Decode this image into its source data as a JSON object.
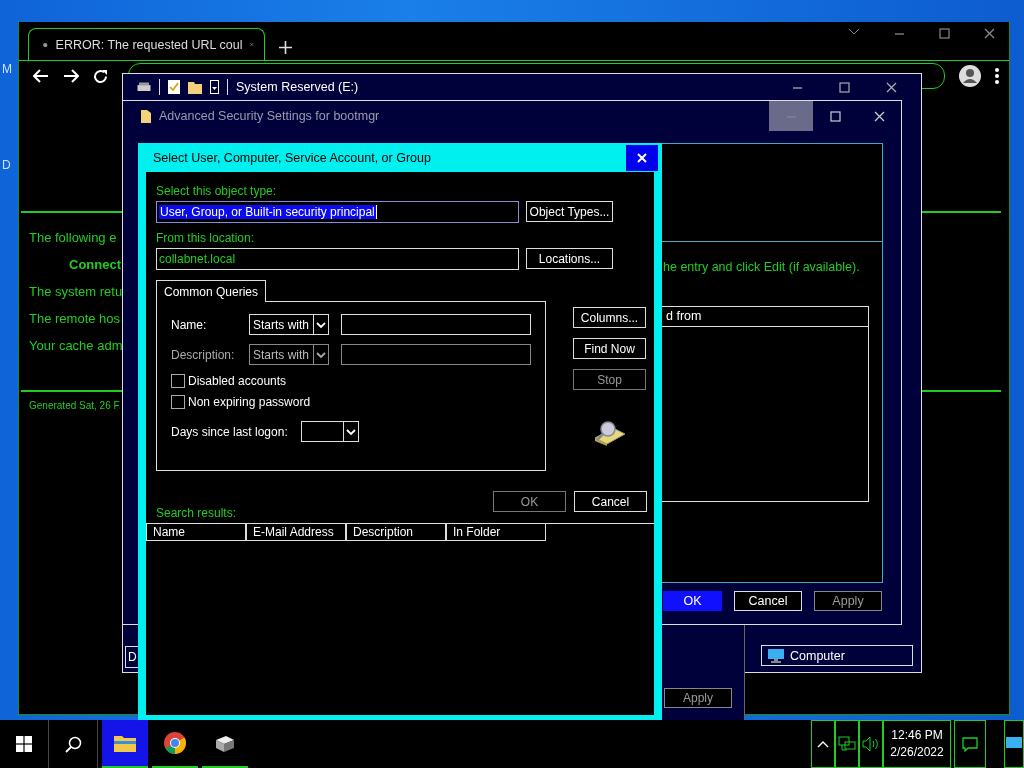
{
  "desktop_icons": [
    {
      "label": "M"
    },
    {
      "label": "D"
    }
  ],
  "browser": {
    "tab_title": "ERROR: The requested URL coul",
    "page_lines": [
      {
        "text": "The following e",
        "kind": "normal"
      },
      {
        "text": "Connect",
        "kind": "heading"
      },
      {
        "text": "The system retu",
        "kind": "normal"
      },
      {
        "text": "The remote hos",
        "kind": "normal"
      },
      {
        "text": "Your cache adm",
        "kind": "normal"
      }
    ],
    "footer": "Generated Sat, 26 F"
  },
  "explorer": {
    "title": "System Reserved (E:)",
    "cut_label": "D",
    "status_item": "Computer",
    "apply_button": "Apply"
  },
  "security_window": {
    "title": "Advanced Security Settings for bootmgr",
    "hint": "he entry and click Edit (if available).",
    "column": "d from",
    "buttons": [
      {
        "label": "OK",
        "kind": "default"
      },
      {
        "label": "Cancel",
        "kind": "normal"
      },
      {
        "label": "Apply",
        "kind": "disabled"
      }
    ]
  },
  "dialog": {
    "title": "Select User, Computer, Service Account, or Group",
    "object_type_label": "Select this object type:",
    "object_type": "User, Group, or Built-in security principal",
    "object_types_button": "Object Types...",
    "location_label": "From this location:",
    "location": "collabnet.local",
    "locations_button": "Locations...",
    "tab": "Common Queries",
    "queries": [
      {
        "label": "Name:",
        "match": "Starts with",
        "disabled": false
      },
      {
        "label": "Description:",
        "match": "Starts with",
        "disabled": true
      }
    ],
    "checkboxes": [
      {
        "label": "Disabled accounts",
        "checked": false
      },
      {
        "label": "Non expiring password",
        "checked": false
      }
    ],
    "days_label": "Days since last logon:",
    "side_buttons": [
      {
        "label": "Columns...",
        "disabled": false
      },
      {
        "label": "Find Now",
        "disabled": false
      },
      {
        "label": "Stop",
        "disabled": true
      }
    ],
    "buttons": [
      {
        "label": "OK",
        "disabled": true
      },
      {
        "label": "Cancel",
        "disabled": false
      }
    ],
    "results_label": "Search results:",
    "columns": [
      "Name",
      "E-Mail Address",
      "Description",
      "In Folder"
    ]
  },
  "taskbar": {
    "apps": [
      {
        "kind": "explorer",
        "selected": true
      },
      {
        "kind": "chrome",
        "selected": false
      },
      {
        "kind": "app",
        "selected": false
      }
    ],
    "time": "12:46 PM",
    "date": "2/26/2022"
  }
}
